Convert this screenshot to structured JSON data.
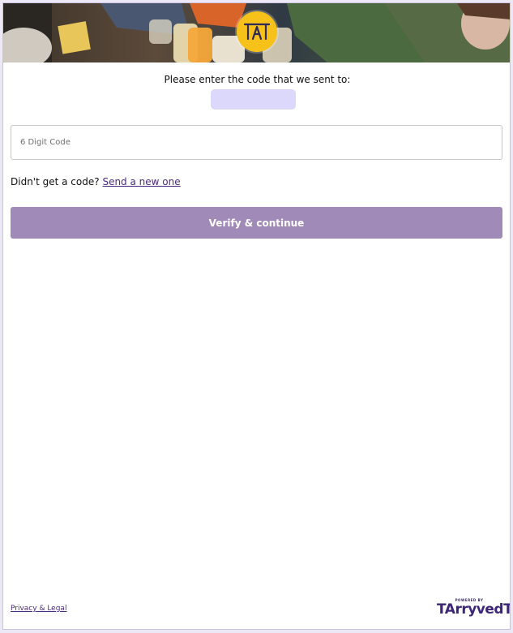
{
  "header": {
    "logo_text": "TAT",
    "hero_image": "people clinking beer glasses"
  },
  "verify": {
    "prompt": "Please enter the code that we sent to:",
    "masked_contact": "",
    "code_placeholder": "6 Digit Code",
    "code_value": "",
    "resend_prefix": "Didn't get a code?",
    "resend_link": "Send a new one",
    "submit_label": "Verify & continue"
  },
  "footer": {
    "privacy_label": "Privacy & Legal",
    "powered_by": "POWERED BY",
    "brand": "Arryved"
  },
  "colors": {
    "accent": "#a08ab8",
    "link": "#4b2a84",
    "logo": "#f6c21a",
    "masked_box": "#dcd8fb"
  }
}
